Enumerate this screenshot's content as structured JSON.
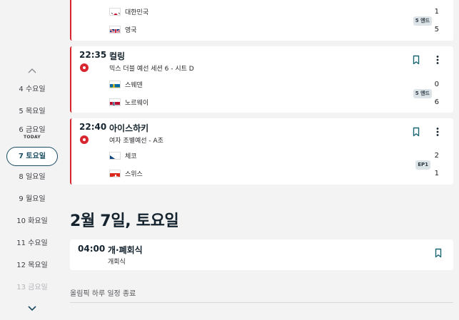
{
  "sidebar": {
    "days": [
      {
        "label": "4 수요일"
      },
      {
        "label": "5 목요일"
      },
      {
        "label": "6 금요일",
        "sub": "TODAY"
      },
      {
        "label": "7 토요일",
        "selected": true
      },
      {
        "label": "8 일요일"
      },
      {
        "label": "9 월요일"
      },
      {
        "label": "10 화요일"
      },
      {
        "label": "11 수요일"
      },
      {
        "label": "12 목요일"
      },
      {
        "label": "13 금요일"
      }
    ]
  },
  "events": [
    {
      "teams": [
        {
          "name": "대한민국",
          "flag": "korea",
          "score": "1"
        },
        {
          "name": "영국",
          "flag": "uk",
          "score": "5"
        }
      ],
      "badge": "5 엔드"
    },
    {
      "time": "22:35",
      "sport": "컬링",
      "event": "믹스 더블 예선 세션 6 - 시트 D",
      "teams": [
        {
          "name": "스웨덴",
          "flag": "sweden",
          "score": "0"
        },
        {
          "name": "노르웨이",
          "flag": "norway",
          "score": "6"
        }
      ],
      "badge": "5 엔드"
    },
    {
      "time": "22:40",
      "sport": "아이스하키",
      "event": "여자 조별예선 - A조",
      "teams": [
        {
          "name": "체코",
          "flag": "czech",
          "score": "2"
        },
        {
          "name": "스위스",
          "flag": "switzerland",
          "score": "1"
        }
      ],
      "badge": "EP1"
    }
  ],
  "date_heading": "2월 7일, 토요일",
  "ceremony": {
    "time": "04:00",
    "sport": "개·폐회식",
    "event": "개회식"
  },
  "end_text": "올림픽 하루 일정 종료",
  "colors": {
    "live": "#d6262f",
    "accent": "#1a4b62",
    "bookmark": "#1a6673"
  }
}
